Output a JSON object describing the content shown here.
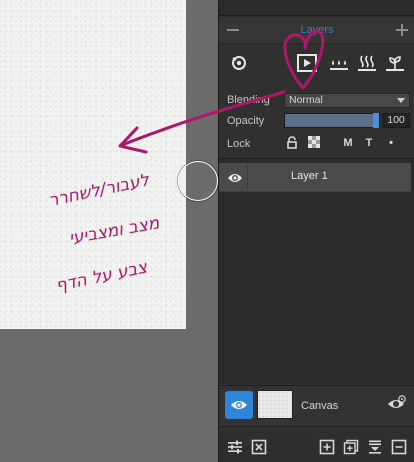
{
  "layers_panel": {
    "title": "Layers",
    "blending": {
      "label": "Blending",
      "value": "Normal"
    },
    "opacity": {
      "label": "Opacity",
      "value": "100",
      "fraction": 1.0
    },
    "lock": {
      "label": "Lock",
      "m_label": "M",
      "t_label": "T",
      "dot_label": "•"
    },
    "layers": [
      {
        "name": "Layer 1",
        "visible": true
      }
    ],
    "canvas": {
      "label": "Canvas"
    }
  },
  "annotation": {
    "lines": [
      "לעבור/לשחרר",
      "מצב ומצביעי",
      "צבע על הדף"
    ],
    "color": "#b0176b"
  },
  "colors": {
    "accent": "#2f86d8",
    "panel_bg": "#303030",
    "title_blue": "#3f7ec2"
  },
  "icons": [
    "minus-icon",
    "plus-icon",
    "layer-options-icon",
    "play-mode-icon",
    "water-drops-icon",
    "steam-icon",
    "plant-icon",
    "eye-icon",
    "padlock-icon",
    "checker-icon",
    "sliders-icon",
    "close-box-icon",
    "add-layer-icon",
    "duplicate-layer-icon",
    "merge-down-icon",
    "delete-layer-icon",
    "canvas-settings-icon"
  ]
}
